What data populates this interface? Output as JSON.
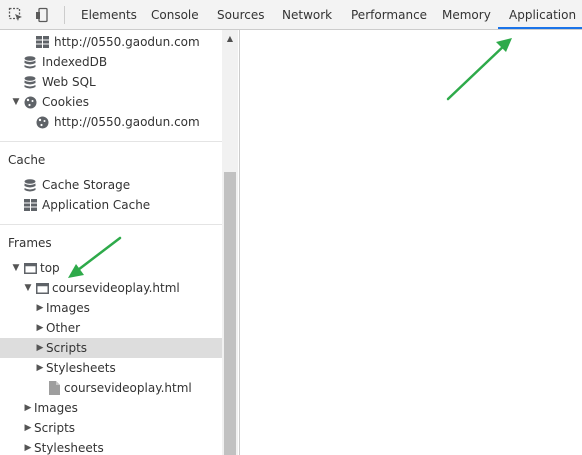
{
  "toolbar": {
    "inspect_icon": "inspect-element-icon",
    "device_icon": "device-toolbar-icon",
    "tabs": [
      {
        "label": "Elements"
      },
      {
        "label": "Console"
      },
      {
        "label": "Sources"
      },
      {
        "label": "Network"
      },
      {
        "label": "Performance"
      },
      {
        "label": "Memory"
      },
      {
        "label": "Application"
      }
    ],
    "active_tab": "Application",
    "accent_color": "#1a73e8"
  },
  "sidebar": {
    "storage": {
      "local_origin": "http://0550.gaodun.com",
      "indexeddb": "IndexedDB",
      "websql": "Web SQL",
      "cookies": "Cookies",
      "cookie_origin": "http://0550.gaodun.com"
    },
    "cache": {
      "title": "Cache",
      "cache_storage": "Cache Storage",
      "application_cache": "Application Cache"
    },
    "frames": {
      "title": "Frames",
      "top": "top",
      "child_frame": "coursevideoplay.html",
      "child_items": {
        "images": "Images",
        "other": "Other",
        "scripts": "Scripts",
        "stylesheets": "Stylesheets",
        "stylesheet_file": "coursevideoplay.html"
      },
      "top_items": {
        "images": "Images",
        "scripts": "Scripts",
        "stylesheets": "Stylesheets"
      }
    },
    "selected_item": "Scripts"
  },
  "annotations": {
    "arrow_color": "#2eaa4a"
  }
}
